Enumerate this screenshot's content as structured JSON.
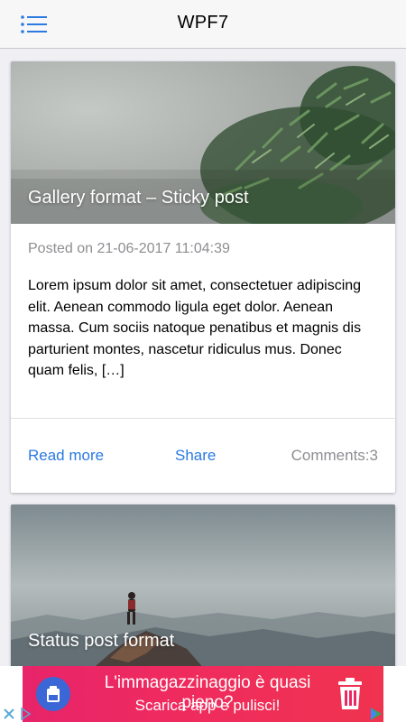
{
  "navbar": {
    "title": "WPF7",
    "menu_icon": "list-menu-icon"
  },
  "posts": [
    {
      "title": "Gallery format – Sticky post",
      "posted": "Posted on 21-06-2017 11:04:39",
      "excerpt": "Lorem ipsum dolor sit amet, consectetuer adipiscing elit. Aenean commodo ligula eget dolor. Aenean massa. Cum sociis natoque penatibus et magnis dis parturient montes, nascetur ridiculus mus. Donec quam felis, […]",
      "read_more": "Read more",
      "share": "Share",
      "comments": "Comments:3"
    },
    {
      "title": "Status post format"
    }
  ],
  "ad": {
    "line1": "L'immagazzinaggio è quasi pieno?",
    "line2": "Scarica app e pulisci!",
    "colors": {
      "background": "#ec2860",
      "app_icon": "#3b66d6"
    },
    "icons": [
      "storage-app-icon",
      "trash-icon",
      "play-store-icon",
      "close-ad-icon",
      "ad-choices-icon"
    ]
  },
  "colors": {
    "accent": "#2a7ae2",
    "muted_text": "#8e8e93",
    "background": "#efeff4"
  }
}
